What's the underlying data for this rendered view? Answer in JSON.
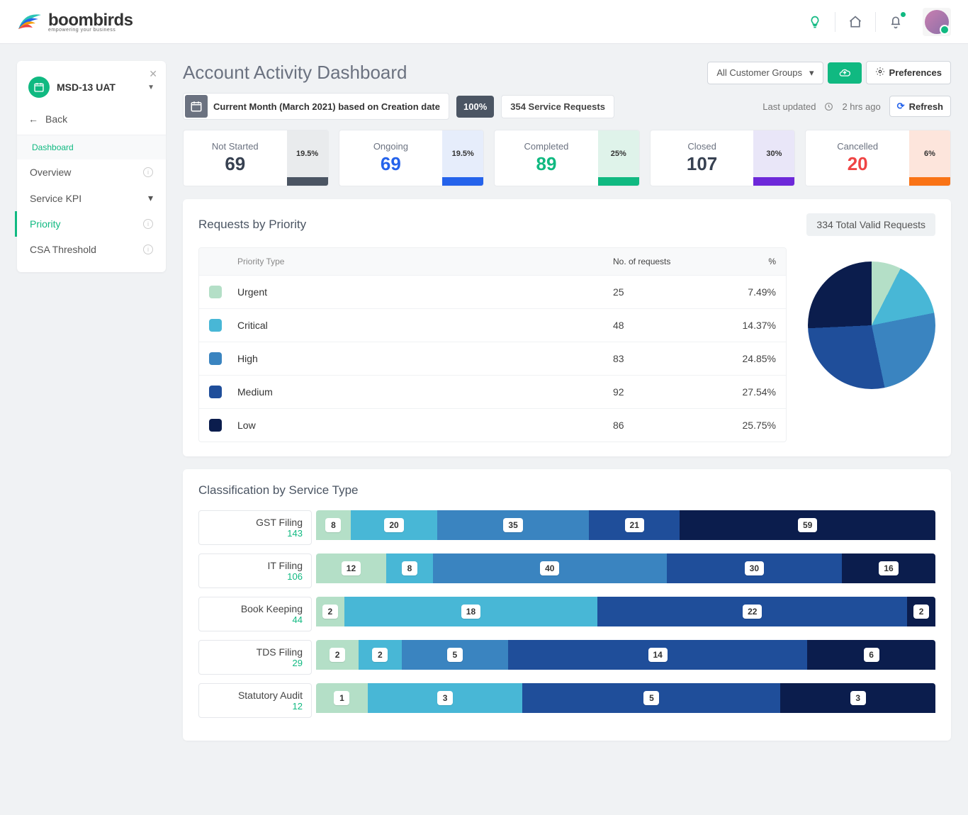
{
  "brand": {
    "name": "boombirds",
    "tagline": "empowering your business"
  },
  "account": {
    "name": "MSD-13 UAT",
    "back": "Back"
  },
  "nav": {
    "heading": "Dashboard",
    "items": [
      {
        "label": "Overview"
      },
      {
        "label": "Service KPI",
        "expandable": true
      },
      {
        "label": "Priority",
        "active": true
      },
      {
        "label": "CSA Threshold"
      }
    ]
  },
  "header": {
    "title": "Account Activity Dashboard",
    "customer_group": "All Customer Groups",
    "preferences": "Preferences"
  },
  "filter": {
    "date_label": "Current Month (March 2021) based on Creation date",
    "percent": "100%",
    "requests": "354 Service Requests",
    "updated": "Last updated",
    "updated_ago": "2 hrs ago",
    "refresh": "Refresh"
  },
  "statuses": [
    {
      "label": "Not Started",
      "value": 69,
      "pct": "19.5%",
      "color": "#4b5563",
      "txt": "#374151",
      "bg": "#e9ebed"
    },
    {
      "label": "Ongoing",
      "value": 69,
      "pct": "19.5%",
      "color": "#2563eb",
      "txt": "#2563eb",
      "bg": "#e6edfb"
    },
    {
      "label": "Completed",
      "value": 89,
      "pct": "25%",
      "color": "#10b981",
      "txt": "#10b981",
      "bg": "#dff3ea"
    },
    {
      "label": "Closed",
      "value": 107,
      "pct": "30%",
      "color": "#6d28d9",
      "txt": "#374151",
      "bg": "#e9e6f8"
    },
    {
      "label": "Cancelled",
      "value": 20,
      "pct": "6%",
      "color": "#f97316",
      "txt": "#ef4444",
      "bg": "#fde5dc"
    }
  ],
  "priority": {
    "title": "Requests by Priority",
    "total": "334 Total Valid Requests",
    "cols": {
      "type": "Priority Type",
      "n": "No. of requests",
      "p": "%"
    },
    "rows": [
      {
        "label": "Urgent",
        "n": 25,
        "pct": "7.49%",
        "color": "#b4dfc7"
      },
      {
        "label": "Critical",
        "n": 48,
        "pct": "14.37%",
        "color": "#48b7d6"
      },
      {
        "label": "High",
        "n": 83,
        "pct": "24.85%",
        "color": "#3a84c0"
      },
      {
        "label": "Medium",
        "n": 92,
        "pct": "27.54%",
        "color": "#1f4e9a"
      },
      {
        "label": "Low",
        "n": 86,
        "pct": "25.75%",
        "color": "#0b1d4d"
      }
    ]
  },
  "classification": {
    "title": "Classification by Service Type",
    "colors": [
      "#b4dfc7",
      "#48b7d6",
      "#3a84c0",
      "#1f4e9a",
      "#0b1d4d"
    ],
    "rows": [
      {
        "name": "GST Filing",
        "total": 143,
        "segs": [
          8,
          20,
          35,
          21,
          59
        ]
      },
      {
        "name": "IT Filing",
        "total": 106,
        "segs": [
          12,
          8,
          40,
          30,
          16
        ]
      },
      {
        "name": "Book Keeping",
        "total": 44,
        "segs": [
          2,
          18,
          0,
          22,
          2
        ]
      },
      {
        "name": "TDS Filing",
        "total": 29,
        "segs": [
          2,
          2,
          5,
          14,
          6
        ]
      },
      {
        "name": "Statutory Audit",
        "total": 12,
        "segs": [
          1,
          3,
          0,
          5,
          3
        ]
      }
    ]
  },
  "chart_data": {
    "pie": {
      "type": "pie",
      "title": "Requests by Priority",
      "series": [
        {
          "name": "Urgent",
          "value": 25,
          "pct": 7.49
        },
        {
          "name": "Critical",
          "value": 48,
          "pct": 14.37
        },
        {
          "name": "High",
          "value": 83,
          "pct": 24.85
        },
        {
          "name": "Medium",
          "value": 92,
          "pct": 27.54
        },
        {
          "name": "Low",
          "value": 86,
          "pct": 25.75
        }
      ]
    },
    "stacked": {
      "type": "bar",
      "title": "Classification by Service Type",
      "categories": [
        "GST Filing",
        "IT Filing",
        "Book Keeping",
        "TDS Filing",
        "Statutory Audit"
      ],
      "series": [
        {
          "name": "Urgent",
          "values": [
            8,
            12,
            2,
            2,
            1
          ]
        },
        {
          "name": "Critical",
          "values": [
            20,
            8,
            18,
            2,
            3
          ]
        },
        {
          "name": "High",
          "values": [
            35,
            40,
            0,
            5,
            0
          ]
        },
        {
          "name": "Medium",
          "values": [
            21,
            30,
            22,
            14,
            5
          ]
        },
        {
          "name": "Low",
          "values": [
            59,
            16,
            2,
            6,
            3
          ]
        }
      ]
    }
  }
}
